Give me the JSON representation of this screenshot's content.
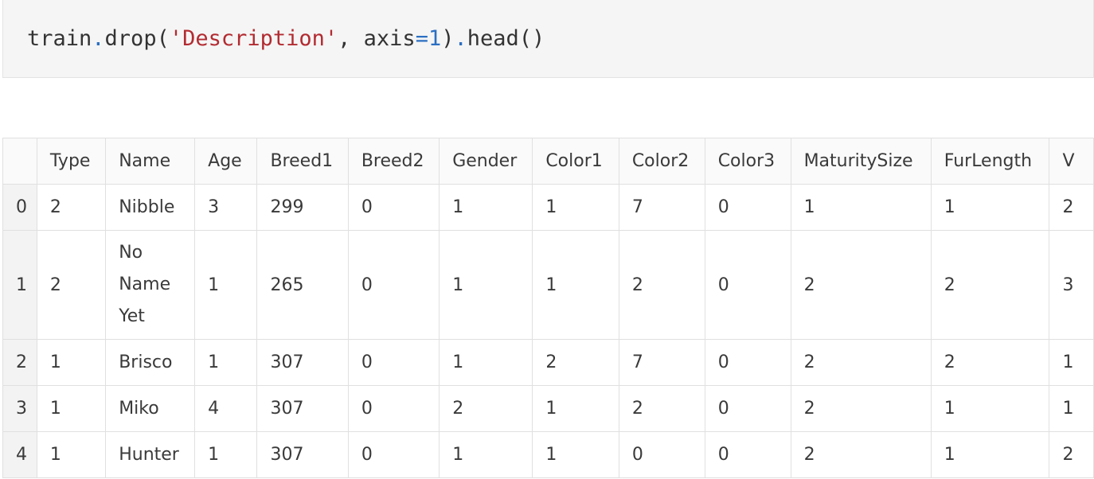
{
  "code_cell": {
    "obj": "train",
    "dot1": ".",
    "method1": "drop(",
    "arg_str": "'Description'",
    "comma": ", axis",
    "eq": "=",
    "num": "1",
    "close": ")",
    "dot2": ".",
    "method2": "head()"
  },
  "table": {
    "columns": [
      "",
      "Type",
      "Name",
      "Age",
      "Breed1",
      "Breed2",
      "Gender",
      "Color1",
      "Color2",
      "Color3",
      "MaturitySize",
      "FurLength",
      "V"
    ],
    "rows": [
      {
        "index": "0",
        "cells": [
          "2",
          "Nibble",
          "3",
          "299",
          "0",
          "1",
          "1",
          "7",
          "0",
          "1",
          "1",
          "2"
        ]
      },
      {
        "index": "1",
        "cells": [
          "2",
          "No Name Yet",
          "1",
          "265",
          "0",
          "1",
          "1",
          "2",
          "0",
          "2",
          "2",
          "3"
        ]
      },
      {
        "index": "2",
        "cells": [
          "1",
          "Brisco",
          "1",
          "307",
          "0",
          "1",
          "2",
          "7",
          "0",
          "2",
          "2",
          "1"
        ]
      },
      {
        "index": "3",
        "cells": [
          "1",
          "Miko",
          "4",
          "307",
          "0",
          "2",
          "1",
          "2",
          "0",
          "2",
          "1",
          "1"
        ]
      },
      {
        "index": "4",
        "cells": [
          "1",
          "Hunter",
          "1",
          "307",
          "0",
          "1",
          "1",
          "0",
          "0",
          "2",
          "1",
          "2"
        ]
      }
    ]
  }
}
